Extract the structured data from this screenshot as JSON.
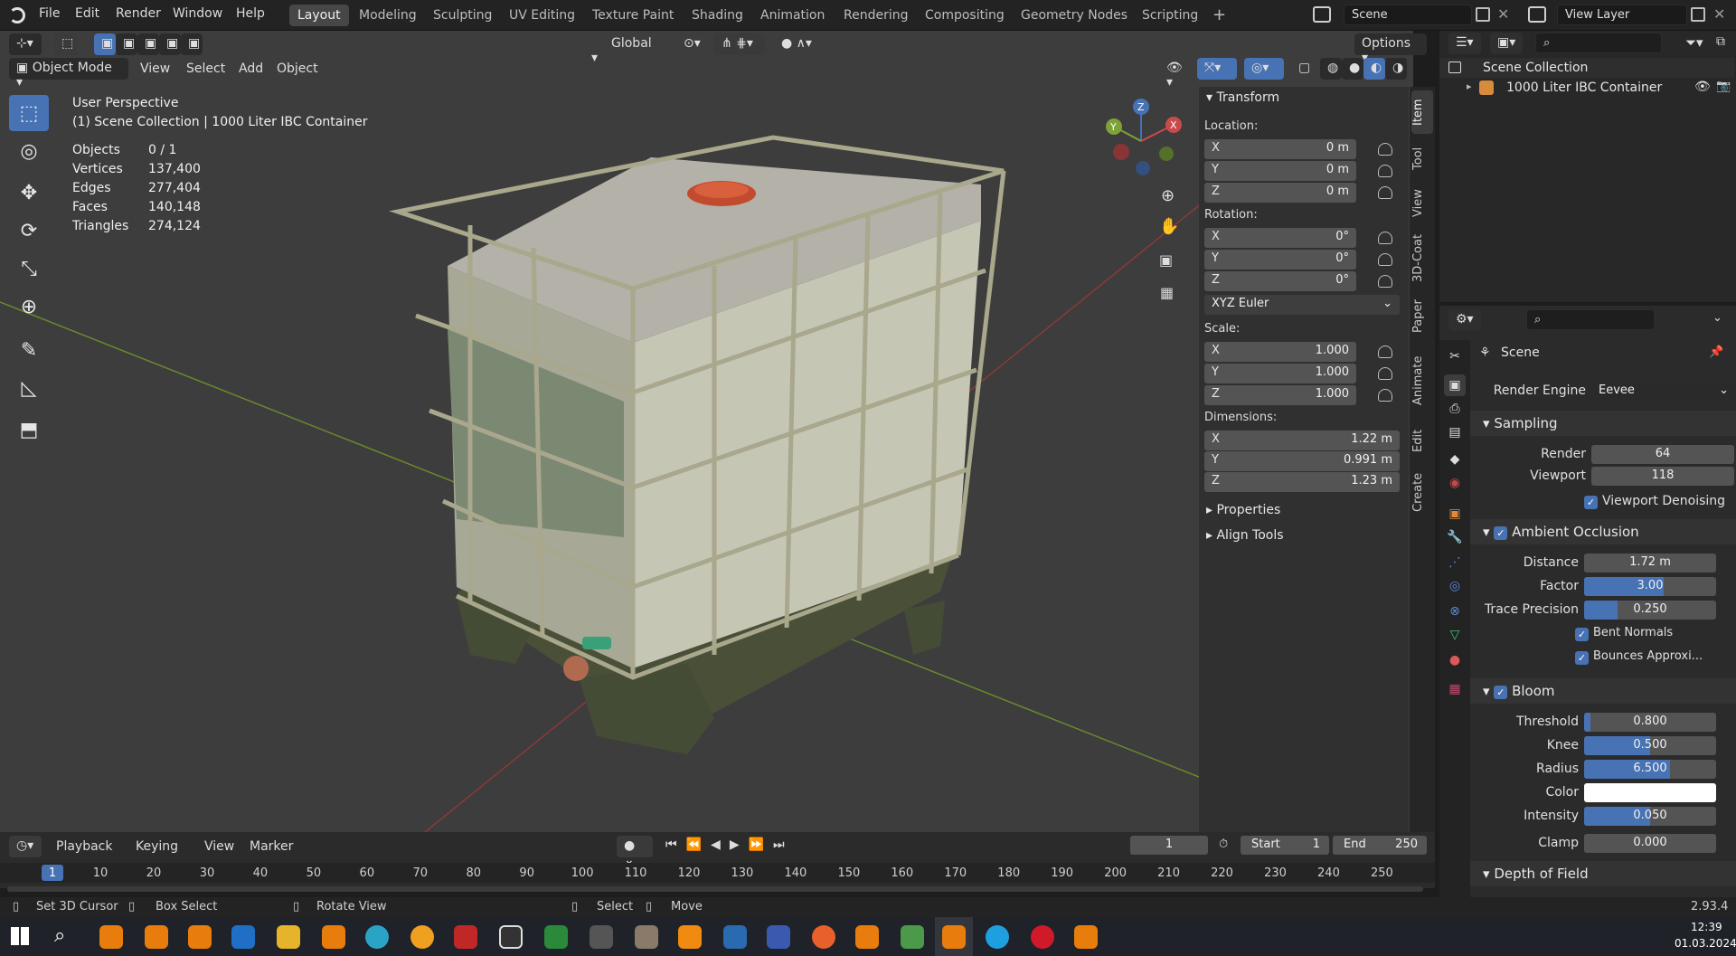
{
  "topbar": {
    "menus": [
      "File",
      "Edit",
      "Render",
      "Window",
      "Help"
    ],
    "workspaces": [
      "Layout",
      "Modeling",
      "Sculpting",
      "UV Editing",
      "Texture Paint",
      "Shading",
      "Animation",
      "Rendering",
      "Compositing",
      "Geometry Nodes",
      "Scripting"
    ],
    "active_workspace": "Layout",
    "add_tab": "+",
    "scene": "Scene",
    "view_layer": "View Layer"
  },
  "tool_header": {
    "transform_orientation": "Global",
    "options": "Options"
  },
  "viewport_header": {
    "mode": "Object Mode",
    "menus": [
      "View",
      "Select",
      "Add",
      "Object"
    ]
  },
  "overlay_info": {
    "view": "User Perspective",
    "collection": "(1) Scene Collection | 1000 Liter IBC Container",
    "stats": [
      {
        "label": "Objects",
        "value": "0 / 1"
      },
      {
        "label": "Vertices",
        "value": "137,400"
      },
      {
        "label": "Edges",
        "value": "277,404"
      },
      {
        "label": "Faces",
        "value": "140,148"
      },
      {
        "label": "Triangles",
        "value": "274,124"
      }
    ]
  },
  "gizmo": {
    "x": "X",
    "y": "Y",
    "z": "Z"
  },
  "npanel": {
    "transform_title": "Transform",
    "location_label": "Location:",
    "location": [
      {
        "axis": "X",
        "value": "0 m"
      },
      {
        "axis": "Y",
        "value": "0 m"
      },
      {
        "axis": "Z",
        "value": "0 m"
      }
    ],
    "rotation_label": "Rotation:",
    "rotation": [
      {
        "axis": "X",
        "value": "0°"
      },
      {
        "axis": "Y",
        "value": "0°"
      },
      {
        "axis": "Z",
        "value": "0°"
      }
    ],
    "rotation_mode": "XYZ Euler",
    "scale_label": "Scale:",
    "scale": [
      {
        "axis": "X",
        "value": "1.000"
      },
      {
        "axis": "Y",
        "value": "1.000"
      },
      {
        "axis": "Z",
        "value": "1.000"
      }
    ],
    "dimensions_label": "Dimensions:",
    "dimensions": [
      {
        "axis": "X",
        "value": "1.22 m"
      },
      {
        "axis": "Y",
        "value": "0.991 m"
      },
      {
        "axis": "Z",
        "value": "1.23 m"
      }
    ],
    "properties": "Properties",
    "align_tools": "Align Tools",
    "tabs": [
      "Item",
      "Tool",
      "View",
      "3D-Coat",
      "Paper",
      "Animate",
      "Edit",
      "Create"
    ]
  },
  "outliner": {
    "root": "Scene Collection",
    "item": "1000 Liter IBC Container"
  },
  "properties": {
    "context": "Scene",
    "render_engine_label": "Render Engine",
    "render_engine": "Eevee",
    "sampling": "Sampling",
    "render_label": "Render",
    "render_value": "64",
    "viewport_label": "Viewport",
    "viewport_value": "118",
    "viewport_denoising": "Viewport Denoising",
    "ao": "Ambient Occlusion",
    "distance_label": "Distance",
    "distance": "1.72 m",
    "factor_label": "Factor",
    "factor": "3.00",
    "factor_fill": 0.6,
    "trace_label": "Trace Precision",
    "trace": "0.250",
    "trace_fill": 0.25,
    "bent_normals": "Bent Normals",
    "bounces": "Bounces Approxi...",
    "bloom": "Bloom",
    "threshold_label": "Threshold",
    "threshold": "0.800",
    "threshold_fill": 0.05,
    "knee_label": "Knee",
    "knee": "0.500",
    "knee_fill": 0.5,
    "radius_label": "Radius",
    "radius": "6.500",
    "radius_fill": 0.65,
    "color_label": "Color",
    "intensity_label": "Intensity",
    "intensity": "0.050",
    "intensity_fill": 0.5,
    "clamp_label": "Clamp",
    "clamp": "0.000",
    "dof": "Depth of Field"
  },
  "timeline": {
    "menus": [
      "Playback",
      "Keying",
      "View",
      "Marker"
    ],
    "current_frame": "1",
    "start_label": "Start",
    "start": "1",
    "end_label": "End",
    "end": "250",
    "ticks": [
      "1",
      "10",
      "20",
      "30",
      "40",
      "50",
      "60",
      "70",
      "80",
      "90",
      "100",
      "110",
      "120",
      "130",
      "140",
      "150",
      "160",
      "170",
      "180",
      "190",
      "200",
      "210",
      "220",
      "230",
      "240",
      "250"
    ]
  },
  "statusbar": {
    "hint1": "Set 3D Cursor",
    "hint2": "Box Select",
    "hint3": "Rotate View",
    "hint4": "Select",
    "hint5": "Move",
    "version": "2.93.4"
  },
  "taskbar": {
    "time": "12:39",
    "date": "01.03.2024"
  }
}
